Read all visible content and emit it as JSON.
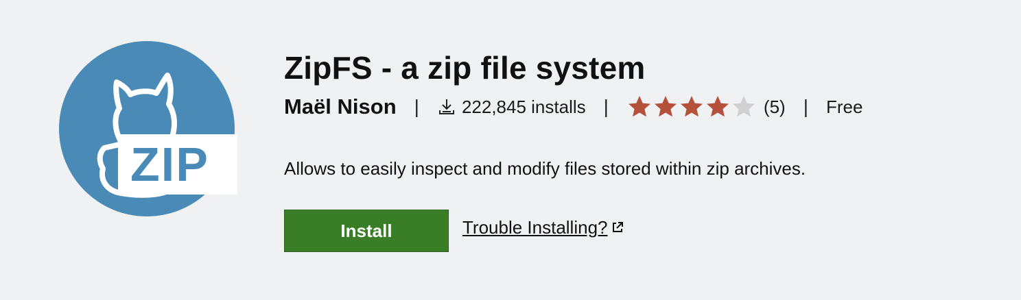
{
  "extension": {
    "title": "ZipFS - a zip file system",
    "publisher": "Maël Nison",
    "separator": "|",
    "installs": "222,845 installs",
    "rating": {
      "stars_filled": 4,
      "stars_total": 5,
      "count": "(5)"
    },
    "price": "Free",
    "description": "Allows to easily inspect and modify files stored within zip archives."
  },
  "logo": {
    "icon": "zip-cat-logo",
    "text": "ZIP",
    "circle_color": "#4a8ab6"
  },
  "actions": {
    "install_label": "Install",
    "trouble_label": "Trouble Installing?",
    "trouble_icon": "external-link-icon"
  },
  "colors": {
    "install_bg": "#3a7d27",
    "star_filled": "#b5513b",
    "star_empty": "#d0d0d0",
    "background": "#f0f1f3"
  }
}
